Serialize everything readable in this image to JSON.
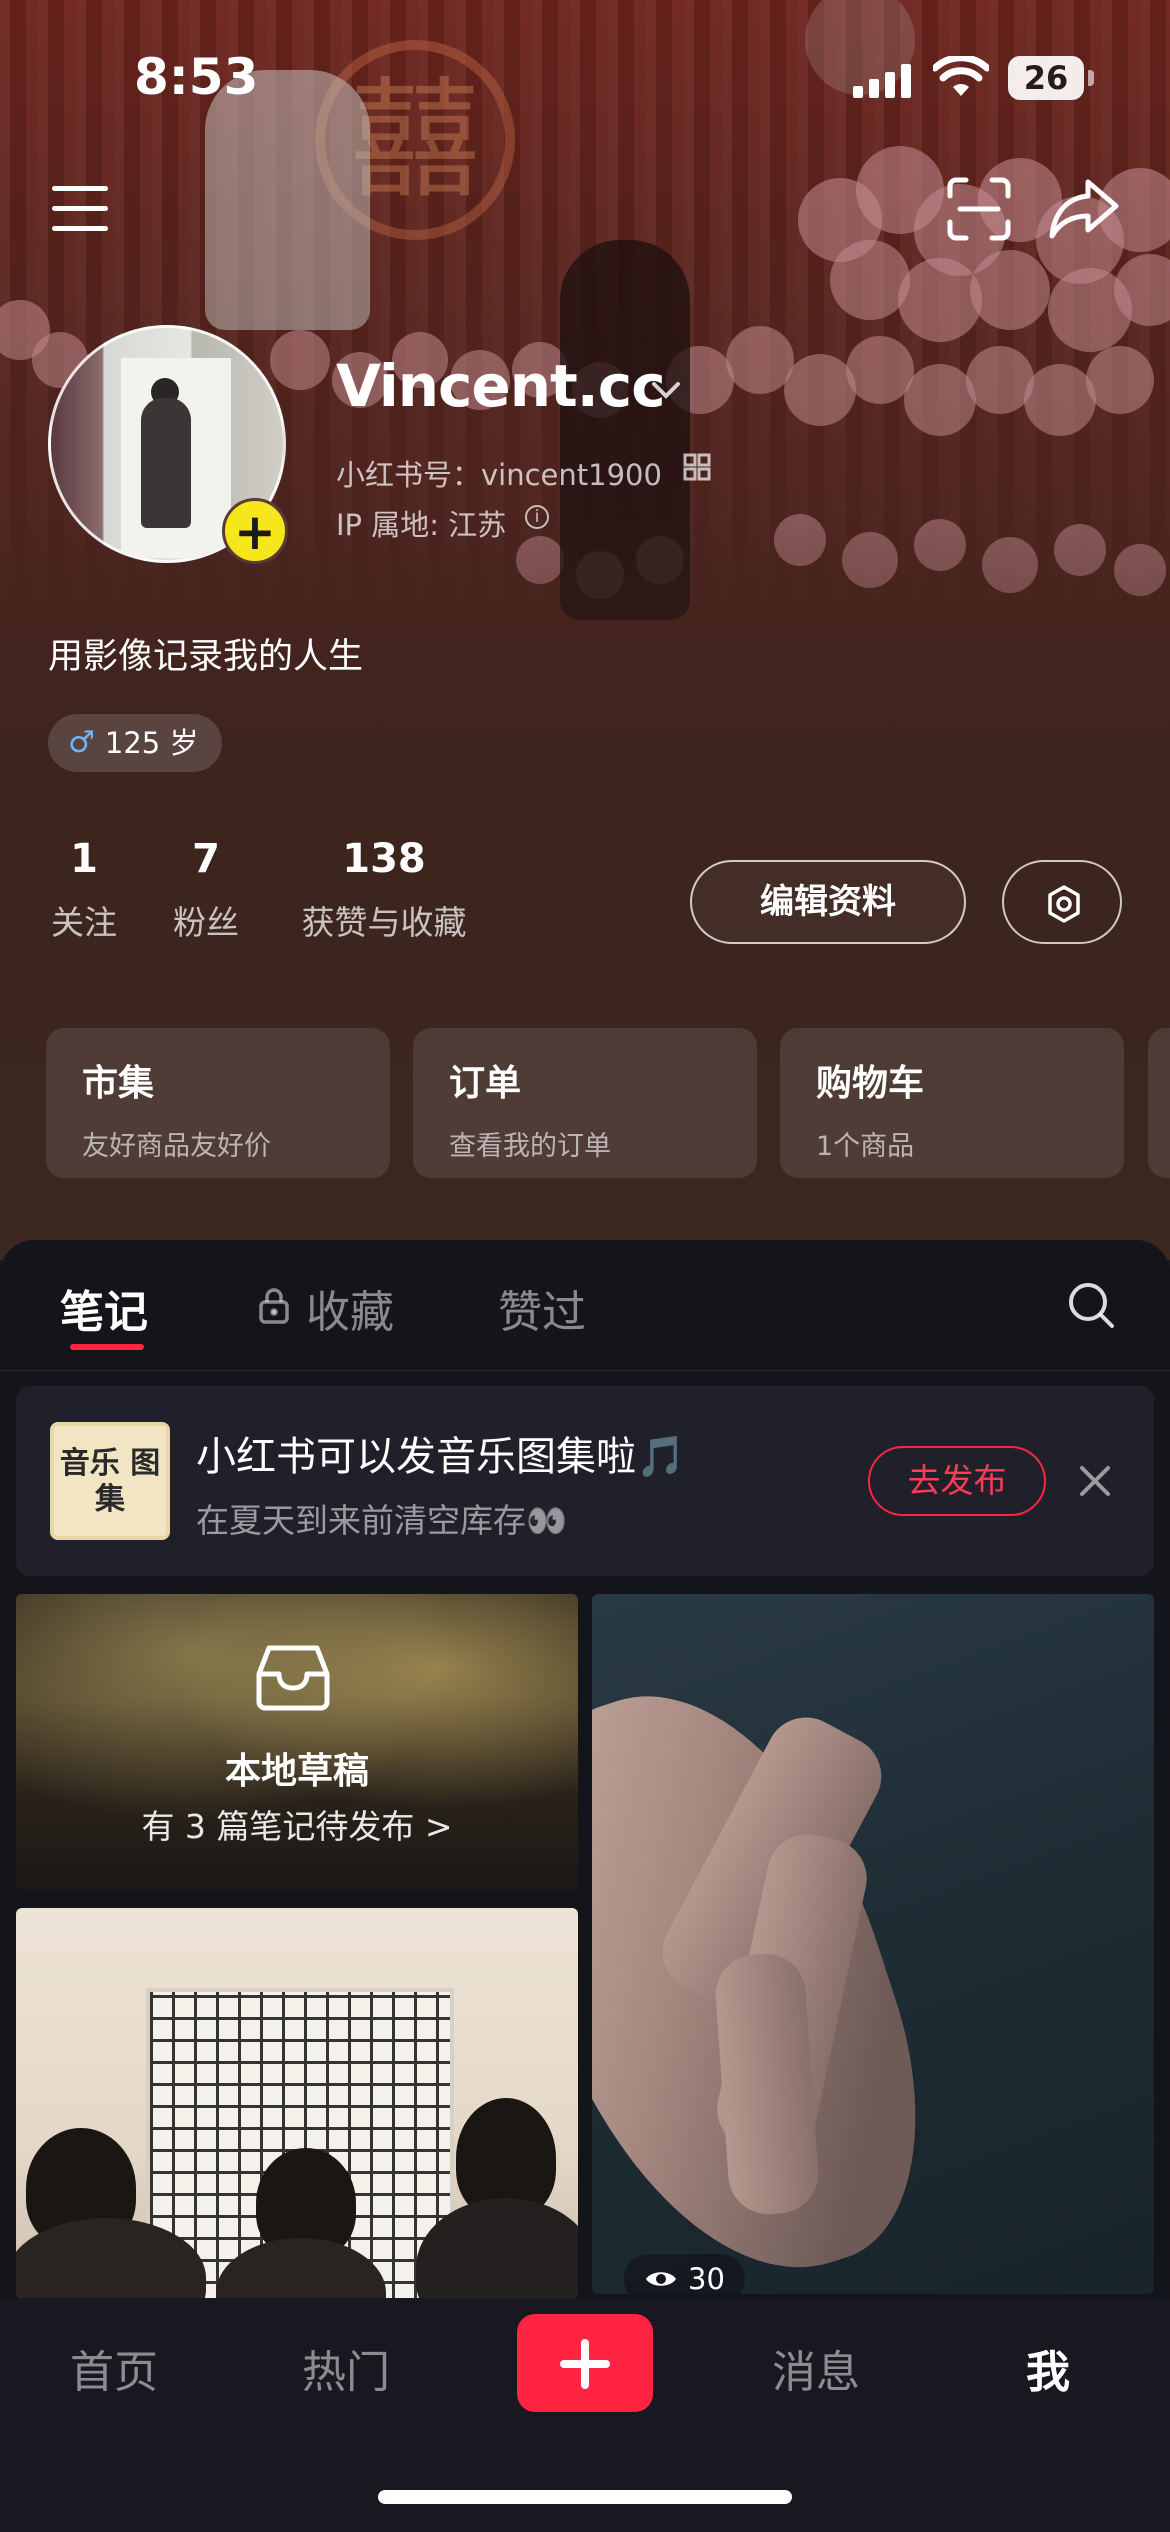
{
  "status_bar": {
    "time": "8:53",
    "battery": "26"
  },
  "profile": {
    "username": "Vincent.cc",
    "xhs_id": "小红书号：vincent1900",
    "ip_location": "IP 属地: 江苏",
    "bio": "用影像记录我的人生",
    "age_badge": "125 岁"
  },
  "stats": [
    {
      "value": "1",
      "label": "关注"
    },
    {
      "value": "7",
      "label": "粉丝"
    },
    {
      "value": "138",
      "label": "获赞与收藏"
    }
  ],
  "actions": {
    "edit_profile": "编辑资料"
  },
  "shortcuts": [
    {
      "title": "市集",
      "subtitle": "友好商品友好价"
    },
    {
      "title": "订单",
      "subtitle": "查看我的订单"
    },
    {
      "title": "购物车",
      "subtitle": "1个商品"
    }
  ],
  "tabs": [
    {
      "label": "笔记",
      "active": true
    },
    {
      "label": "收藏",
      "locked": true
    },
    {
      "label": "赞过"
    }
  ],
  "promo": {
    "thumb_text": "音乐 图集",
    "title": "小红书可以发音乐图集啦🎵",
    "subtitle": "在夏天到来前清空库存👀",
    "button": "去发布"
  },
  "drafts": {
    "title": "本地草稿",
    "subtitle": "有 3 篇笔记待发布 >"
  },
  "note_views": "30",
  "bottom_nav": {
    "home": "首页",
    "trending": "热门",
    "messages": "消息",
    "me": "我"
  },
  "colors": {
    "accent": "#ff2442",
    "avatar_add": "#f6e61c"
  }
}
